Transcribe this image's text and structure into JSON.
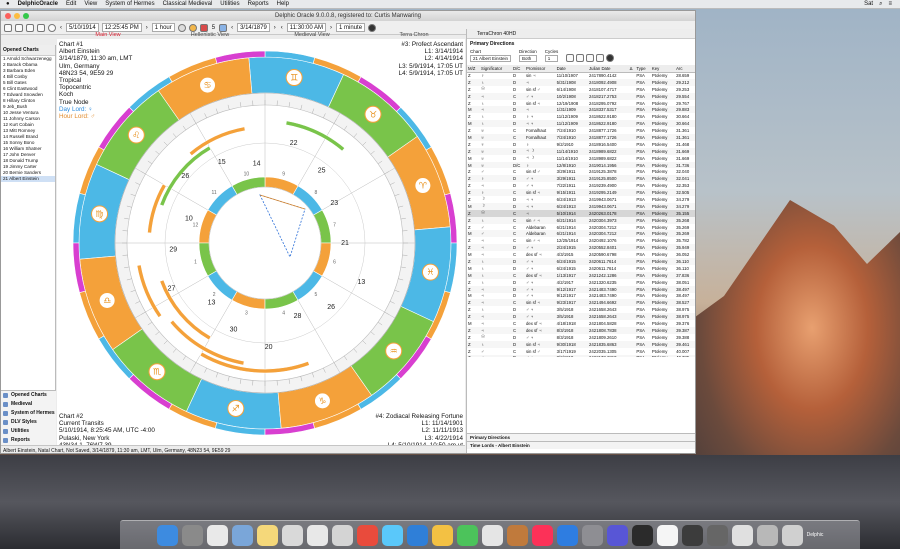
{
  "menubar": {
    "app": "DelphicOracle",
    "items": [
      "Edit",
      "View",
      "System of Hermes",
      "Classical Medieval",
      "Utilities",
      "Reports",
      "Help"
    ],
    "clock": "Sat"
  },
  "window": {
    "title": "Delphic Oracle 9.0.0.8, registered to: Curtis Manwaring"
  },
  "toolbar": {
    "date1": "5/10/1914",
    "time1": "12:25:45 PM",
    "step1": "1 hour",
    "num": "5",
    "date2": "3/14/1879",
    "time2": "11:30:00 AM",
    "step2": "1 minute"
  },
  "tabs": [
    "Main View",
    "Hellenistic View",
    "Medieval View",
    "Terra Chron"
  ],
  "opened_charts": {
    "header": "Opened Charts",
    "items": [
      "1 Arnold Schwarzenegg",
      "2 Barack Obama",
      "3 Barbara Eden",
      "4 Bill Cosby",
      "5 Bill Gates",
      "6 Clint Eastwood",
      "7 Edward Snowden",
      "8 Hillary Clinton",
      "9 Jeb_Bush",
      "10 Jesse Ventura",
      "11 Johnny Carson",
      "12 Kurt Cobain",
      "13 Mitt Romney",
      "14 Russell Brand",
      "15 Sonny Bono",
      "16 William Shatner",
      "17 John Denver",
      "18 Donald Trump",
      "19 Jimmy Carter",
      "20 Bernie Sanders",
      "21 Albert Einstein"
    ]
  },
  "left_nav": [
    "Opened Charts",
    "Medieval",
    "System of Hermes",
    "DLV Styles",
    "Utilities",
    "Reports"
  ],
  "chart1": {
    "lines": [
      "Chart #1",
      "Albert Einstein",
      "3/14/1879, 11:30 am, LMT",
      "Ulm, Germany",
      "48N23 54, 9E59 29",
      "Tropical",
      "Topocentric",
      "Koch",
      "True Node"
    ],
    "day_lord": "Day Lord: ♀",
    "hour_lord": "Hour Lord: ♂"
  },
  "chart2": {
    "lines": [
      "Chart #2",
      "Current Transits",
      "5/10/1914, 8:25:45 AM, UTC -4:00",
      "Pulaski, New York",
      "43N34 1, 76W7 39"
    ]
  },
  "profect": {
    "lines": [
      "#3: Profect Ascendant",
      "L1: 3/14/1914",
      "L2: 4/14/1914",
      "L3: 5/9/1914, 17:05 UT",
      "L4: 5/9/1914, 17:05 UT"
    ]
  },
  "zodiac": {
    "lines": [
      "#4: Zodiacal Releasing Fortune",
      "L1: 11/14/1901",
      "L2: 11/11/1913",
      "L3: 4/22/1914",
      "L4: 5/10/1914, 10:50 am ut"
    ]
  },
  "right_pane": {
    "tab": "TerraChron 40HD",
    "title": "Primary Directions",
    "chart_label": "Chart",
    "chart_value": "21 Albert Einstein",
    "direction_label": "Direction",
    "direction_value": "Both",
    "cycles_label": "Cycles",
    "cycles_value": "1",
    "columns": [
      "M/Z",
      "Significator",
      "D/C",
      "Promissor",
      "Date",
      "Julian Date",
      "Δ",
      "Type",
      "Key",
      "Arc"
    ],
    "rows": [
      [
        "Z",
        "♇",
        "D",
        "sin ♃",
        "11/10/1907",
        "2417890.4142",
        "PSA",
        "Ptolemy",
        "28.659"
      ],
      [
        "Z",
        "♄",
        "D",
        "♃",
        "5/31/1908",
        "2418092.4908",
        "PSA",
        "Ptolemy",
        "29.212"
      ],
      [
        "Z",
        "☉",
        "D",
        "sin sf ♂",
        "6/14/1908",
        "2418107.4717",
        "PSA",
        "Ptolemy",
        "29.253"
      ],
      [
        "Z",
        "♃",
        "C",
        "♂ ♃",
        "10/2/1908",
        "2418217.2753",
        "PSA",
        "Ptolemy",
        "29.554"
      ],
      [
        "Z",
        "♄",
        "D",
        "sin sf ♃",
        "12/19/1908",
        "2418295.0792",
        "PSA",
        "Ptolemy",
        "29.767"
      ],
      [
        "M",
        "♃",
        "D",
        "♃",
        "1/31/1909",
        "2418337.5317",
        "PSA",
        "Ptolemy",
        "29.883"
      ],
      [
        "Z",
        "♄",
        "D",
        "♀ ♃",
        "11/12/1909",
        "2418622.9180",
        "PSA",
        "Ptolemy",
        "30.664"
      ],
      [
        "M",
        "♄",
        "D",
        "♃ ♃",
        "11/12/1909",
        "2418622.9180",
        "PSA",
        "Ptolemy",
        "30.664"
      ],
      [
        "Z",
        "♅",
        "C",
        "Fomalhaut",
        "7/24/1910",
        "2418877.1726",
        "PSA",
        "Ptolemy",
        "31.361"
      ],
      [
        "M",
        "♅",
        "C",
        "Fomalhaut",
        "7/24/1910",
        "2418877.1726",
        "PSA",
        "Ptolemy",
        "31.361"
      ],
      [
        "Z",
        "♆",
        "D",
        "♀",
        "9/2/1910",
        "2418916.5400",
        "PSA",
        "Ptolemy",
        "31.468"
      ],
      [
        "Z",
        "♅",
        "D",
        "♃ ☽",
        "11/14/1910",
        "2418989.6822",
        "PSA",
        "Ptolemy",
        "31.669"
      ],
      [
        "M",
        "♅",
        "D",
        "♃ ☽",
        "11/14/1910",
        "2418989.6822",
        "PSA",
        "Ptolemy",
        "31.669"
      ],
      [
        "M",
        "♅",
        "D/C",
        "♀",
        "12/8/1910",
        "2419014.1956",
        "PSA",
        "Ptolemy",
        "31.736"
      ],
      [
        "Z",
        "♂",
        "C",
        "sin sf ♂",
        "3/29/1911",
        "2419125.3878",
        "PSA",
        "Ptolemy",
        "32.040"
      ],
      [
        "Z",
        "♀",
        "D",
        "♂ ♃",
        "3/29/1911",
        "2419125.8500",
        "PSA",
        "Ptolemy",
        "32.041"
      ],
      [
        "Z",
        "♃",
        "D",
        "♂ ♃",
        "7/22/1911",
        "2419239.4900",
        "PSA",
        "Ptolemy",
        "32.353"
      ],
      [
        "Z",
        "♀",
        "C",
        "sin sf ♃",
        "9/15/1911",
        "2419295.2149",
        "PSA",
        "Ptolemy",
        "32.505"
      ],
      [
        "Z",
        "☽",
        "D",
        "♃ ♃",
        "6/24/1913",
        "2419943.0671",
        "PSA",
        "Ptolemy",
        "34.279"
      ],
      [
        "M",
        "☽",
        "D",
        "♃ ♃",
        "6/24/1913",
        "2419943.0671",
        "PSA",
        "Ptolemy",
        "34.279"
      ],
      [
        "Z",
        "☉",
        "C",
        "♃",
        "5/10/1914",
        "2420263.0178",
        "PSA",
        "Ptolemy",
        "35.155"
      ],
      [
        "Z",
        "♄",
        "C",
        "sin ♂ ♃",
        "6/21/1914",
        "2420304.3973",
        "PSA",
        "Ptolemy",
        "35.268"
      ],
      [
        "Z",
        "♂",
        "C",
        "Aldebaran",
        "6/21/1914",
        "2420304.7212",
        "PSA",
        "Ptolemy",
        "35.269"
      ],
      [
        "M",
        "♂",
        "C",
        "Aldebaran",
        "6/21/1914",
        "2420304.7212",
        "PSA",
        "Ptolemy",
        "35.269"
      ],
      [
        "Z",
        "♃",
        "C",
        "sin ♂ ♃",
        "12/25/1914",
        "2420492.1076",
        "PSA",
        "Ptolemy",
        "35.782"
      ],
      [
        "Z",
        "♃",
        "D",
        "♂ ♃",
        "2/24/1915",
        "2420552.8401",
        "PSA",
        "Ptolemy",
        "35.949"
      ],
      [
        "M",
        "♃",
        "C",
        "dex sf ♃",
        "4/3/1915",
        "2420590.6798",
        "PSA",
        "Ptolemy",
        "36.052"
      ],
      [
        "Z",
        "♄",
        "D",
        "♂ ♃",
        "6/24/1915",
        "2420611.7614",
        "PSA",
        "Ptolemy",
        "36.110"
      ],
      [
        "M",
        "♄",
        "D",
        "♂ ♃",
        "6/24/1915",
        "2420611.7614",
        "PSA",
        "Ptolemy",
        "36.110"
      ],
      [
        "M",
        "♄",
        "C",
        "dex sf ♃",
        "1/13/1917",
        "2421242.1286",
        "PSA",
        "Ptolemy",
        "37.836"
      ],
      [
        "Z",
        "♄",
        "D",
        "♂ ♃",
        "4/2/1917",
        "2421320.6235",
        "PSA",
        "Ptolemy",
        "38.051"
      ],
      [
        "Z",
        "♃",
        "D",
        "♂ ♃",
        "9/12/1917",
        "2421483.7490",
        "PSA",
        "Ptolemy",
        "38.497"
      ],
      [
        "M",
        "♃",
        "D",
        "♂ ♃",
        "9/12/1917",
        "2421483.7490",
        "PSA",
        "Ptolemy",
        "38.497"
      ],
      [
        "Z",
        "♃",
        "C",
        "sin sf ♃",
        "9/23/1917",
        "2421494.6692",
        "PSA",
        "Ptolemy",
        "38.527"
      ],
      [
        "Z",
        "♄",
        "D",
        "♂ ♃",
        "3/5/1918",
        "2421658.2643",
        "PSA",
        "Ptolemy",
        "38.975"
      ],
      [
        "Z",
        "♃",
        "D",
        "♂ ♃",
        "3/5/1918",
        "2421658.2643",
        "PSA",
        "Ptolemy",
        "38.975"
      ],
      [
        "M",
        "♃",
        "C",
        "dex sf ♃",
        "4/18/1918",
        "2421804.5828",
        "PSA",
        "Ptolemy",
        "39.376"
      ],
      [
        "Z",
        "♃",
        "C",
        "dex sf ♃",
        "8/3/1918",
        "2421808.7838",
        "PSA",
        "Ptolemy",
        "39.387"
      ],
      [
        "Z",
        "☉",
        "D",
        "♂ ♃",
        "8/3/1918",
        "2421809.2610",
        "PSA",
        "Ptolemy",
        "39.388"
      ],
      [
        "Z",
        "♄",
        "D",
        "sin sf ♃",
        "9/30/1918",
        "2421835.6863",
        "PSA",
        "Ptolemy",
        "39.461"
      ],
      [
        "Z",
        "♂",
        "C",
        "sin sf ♂",
        "3/17/1919",
        "2422035.1305",
        "PSA",
        "Ptolemy",
        "40.007"
      ],
      [
        "Z",
        "♃",
        "D",
        "♂ ♃",
        "8/2/1919",
        "2422173.2810",
        "PSA",
        "Ptolemy",
        "40.385"
      ]
    ],
    "footer1": "Primary Directions",
    "footer2": "Time Lords - Albert Einstein"
  },
  "status": "Albert Einstein, Natal Chart, Not Saved, 3/14/1879, 11:30 am, LMT, Ulm, Germany, 48N23 54, 9E59 29",
  "wheel": {
    "signs_outer": [
      "♈",
      "♉",
      "♊",
      "♋",
      "♌",
      "♍",
      "♎",
      "♏",
      "♐",
      "♑",
      "♒",
      "♓"
    ],
    "house_numbers": [
      "1",
      "2",
      "3",
      "4",
      "5",
      "6",
      "7",
      "8",
      "9",
      "10",
      "11",
      "12"
    ],
    "planet_degrees": [
      "23",
      "25",
      "22",
      "14",
      "15",
      "26",
      "10",
      "29",
      "27",
      "13",
      "30",
      "20",
      "28",
      "26",
      "13",
      "21"
    ]
  },
  "dock": {
    "label": "Delphic"
  }
}
